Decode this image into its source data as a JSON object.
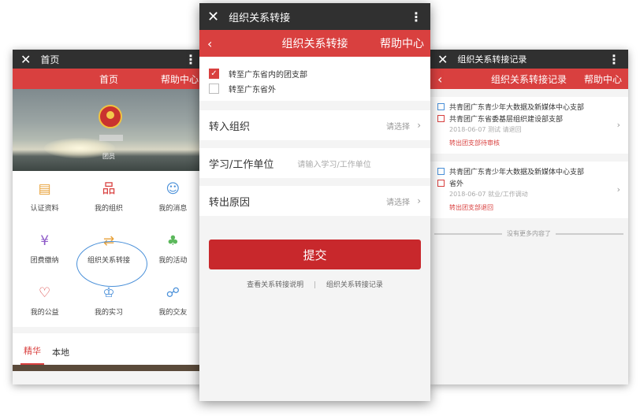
{
  "left": {
    "titlebar": {
      "close": "✕",
      "title": "首页",
      "more": "⋮"
    },
    "nav": {
      "title": "首页",
      "help": "帮助中心"
    },
    "profile": {
      "role": "团员"
    },
    "menu": [
      {
        "label": "认证资料",
        "icon": "id-card-icon",
        "glyph": "▤",
        "color": "#e8a23a"
      },
      {
        "label": "我的组织",
        "icon": "org-chart-icon",
        "glyph": "品",
        "color": "#d9403f"
      },
      {
        "label": "我的消息",
        "icon": "chat-icon",
        "glyph": "☺",
        "color": "#4a90d9"
      },
      {
        "label": "团费缴纳",
        "icon": "yuan-icon",
        "glyph": "¥",
        "color": "#8e5ac8"
      },
      {
        "label": "组织关系转接",
        "icon": "transfer-arrows-icon",
        "glyph": "⇄",
        "color": "#e8a23a"
      },
      {
        "label": "我的活动",
        "icon": "tree-icon",
        "glyph": "♣",
        "color": "#5cb85c"
      },
      {
        "label": "我的公益",
        "icon": "heart-icon",
        "glyph": "♡",
        "color": "#d9403f"
      },
      {
        "label": "我的实习",
        "icon": "graduate-icon",
        "glyph": "♔",
        "color": "#4a90d9"
      },
      {
        "label": "我的交友",
        "icon": "friends-icon",
        "glyph": "☍",
        "color": "#4a90d9"
      }
    ],
    "tabs": [
      "精华",
      "本地"
    ]
  },
  "middle": {
    "titlebar": {
      "close": "✕",
      "title": "组织关系转接",
      "more": "⋮"
    },
    "nav": {
      "back": "‹",
      "title": "组织关系转接",
      "help": "帮助中心"
    },
    "options": [
      {
        "label": "转至广东省内的团支部",
        "checked": true
      },
      {
        "label": "转至广东省外",
        "checked": false
      }
    ],
    "fields": {
      "org_label": "转入组织",
      "org_placeholder": "请选择",
      "unit_label": "学习/工作单位",
      "unit_placeholder": "请输入学习/工作单位",
      "reason_label": "转出原因",
      "reason_placeholder": "请选择"
    },
    "submit": "提交",
    "link_help": "查看关系转接说明",
    "link_sep": "|",
    "link_records": "组织关系转接记录"
  },
  "right": {
    "titlebar": {
      "close": "✕",
      "title": "组织关系转接记录",
      "more": "⋮"
    },
    "nav": {
      "back": "‹",
      "title": "组织关系转接记录",
      "help": "帮助中心"
    },
    "records": [
      {
        "from": "共青团广东青少年大数据及新媒体中心支部",
        "to": "共青团广东省委基层组织建设部支部",
        "meta": "2018-06-07  测试 请退回",
        "status": "转出团支部待审核"
      },
      {
        "from": "共青团广东青少年大数据及新媒体中心支部",
        "to": "省外",
        "meta": "2018-06-07  就业/工作调动",
        "status": "转出团支部退回"
      }
    ],
    "no_more": "没有更多内容了"
  }
}
